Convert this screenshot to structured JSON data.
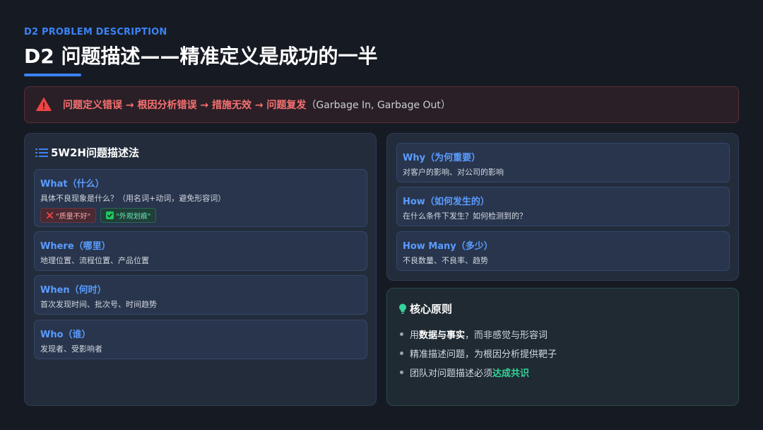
{
  "header": {
    "subtitle": "D2 PROBLEM DESCRIPTION",
    "title": "D2 问题描述——精准定义是成功的一半"
  },
  "alert": {
    "icon": "warning-icon",
    "red_text": "问题定义错误 → 根因分析错误 → 措施无效 → 问题复发",
    "gray_text": "（Garbage In, Garbage Out）"
  },
  "method_panel": {
    "icon": "list-icon",
    "title": "5W2H问题描述法",
    "what": {
      "title": "What（什么）",
      "desc": "具体不良现象是什么？（用名词+动词，避免形容词）",
      "bad_tag": "\"质量不好\"",
      "good_tag": "\"外观划痕\""
    },
    "where": {
      "title": "Where（哪里）",
      "desc": "地理位置、流程位置、产品位置"
    },
    "when": {
      "title": "When（何时）",
      "desc": "首次发现时间、批次号、时间趋势"
    },
    "who": {
      "title": "Who（谁）",
      "desc": "发现者、受影响者"
    }
  },
  "right_panel": {
    "why": {
      "title": "Why（为何重要）",
      "desc": "对客户的影响、对公司的影响"
    },
    "how": {
      "title": "How（如何发生的）",
      "desc": "在什么条件下发生？如何检测到的？"
    },
    "how_many": {
      "title": "How Many（多少）",
      "desc": "不良数量、不良率、趋势"
    }
  },
  "core": {
    "icon": "lightbulb-icon",
    "title": "核心原则",
    "b1_pre": "用",
    "b1_strong": "数据与事实",
    "b1_post": "，而非感觉与形容词",
    "b2": "精准描述问题，为根因分析提供靶子",
    "b3_pre": "团队对问题描述必须",
    "b3_strong": "达成共识"
  },
  "colors": {
    "accent": "#3b82f6",
    "card_title": "#5b9cff",
    "alert_red": "#f87171",
    "success_green": "#34d399"
  }
}
